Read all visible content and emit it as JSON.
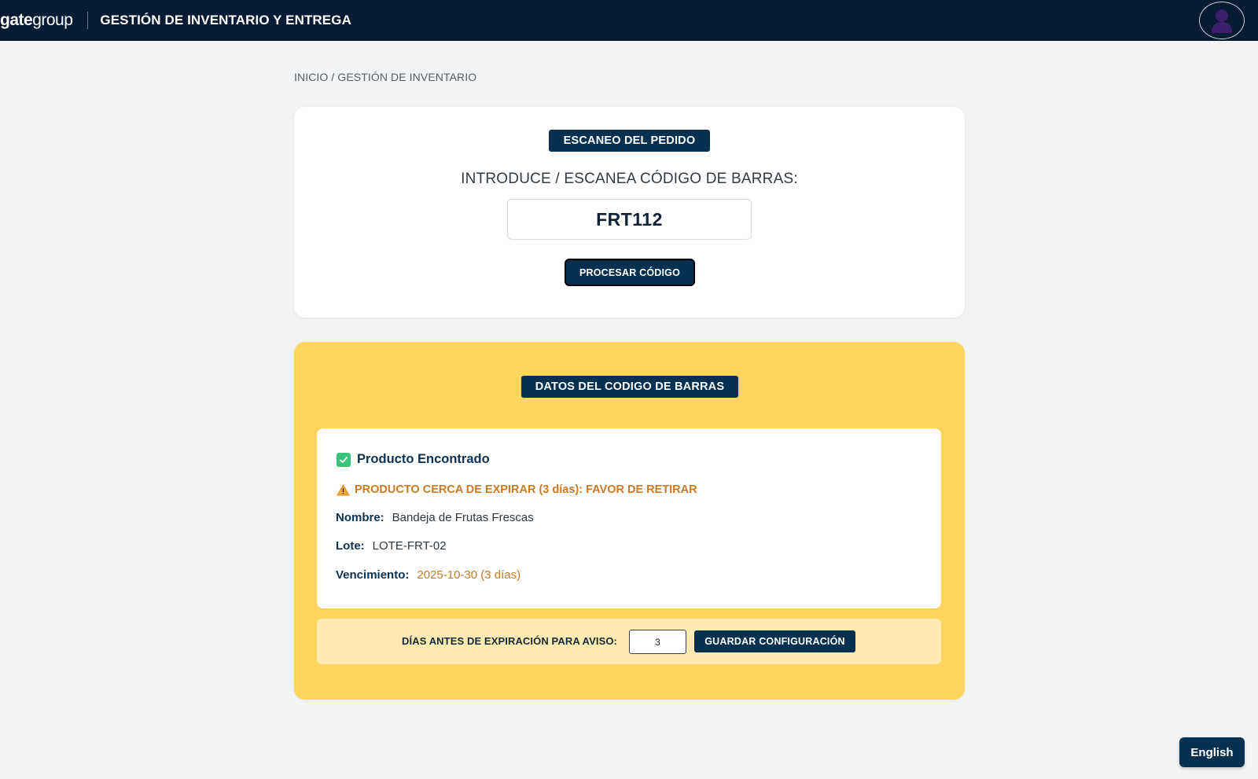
{
  "header": {
    "logo_bold": "gate",
    "logo_regular": "group",
    "app_title": "GESTIÓN DE INVENTARIO Y ENTREGA",
    "avatar_icon": "user-avatar-icon"
  },
  "breadcrumb": "INICIO / GESTIÓN DE INVENTARIO",
  "scan": {
    "badge": "ESCANEO DEL PEDIDO",
    "label": "INTRODUCE / ESCANEA CÓDIGO DE BARRAS:",
    "code_value": "FRT112",
    "process_button": "PROCESAR CÓDIGO"
  },
  "barcode_data": {
    "badge": "DATOS DEL CODIGO DE BARRAS",
    "status": "Producto Encontrado",
    "status_icon": "check-icon",
    "warning": "PRODUCTO CERCA DE EXPIRAR (3 días): FAVOR DE RETIRAR",
    "warning_icon": "warning-icon",
    "fields": {
      "nombre_label": "Nombre:",
      "nombre_value": "Bandeja de Frutas Frescas",
      "lote_label": "Lote:",
      "lote_value": "LOTE-FRT-02",
      "vencimiento_label": "Vencimiento:",
      "vencimiento_value": "2025-10-30 (3 días)"
    },
    "config": {
      "label": "DÍAS ANTES DE EXPIRACIÓN PARA AVISO:",
      "days_value": "3",
      "save_button": "GUARDAR CONFIGURACIÓN"
    }
  },
  "language_button": "English",
  "colors": {
    "navy": "#071c33",
    "badge_blue": "#06304f",
    "yellow_panel": "#ffd45c",
    "config_bar": "#ffeab2",
    "warning_orange": "#c97a25",
    "success_green": "#34c47a"
  }
}
